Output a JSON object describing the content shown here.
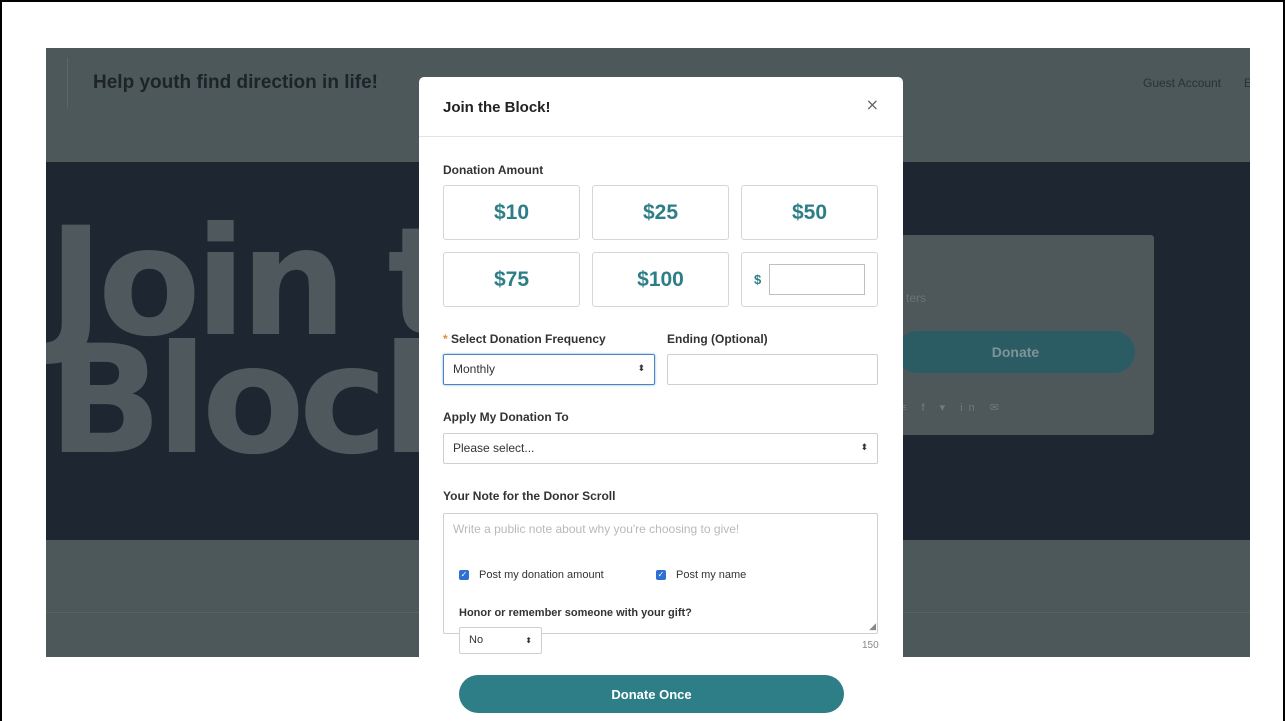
{
  "background": {
    "site_title": "Help youth find direction in life!",
    "guest_account": "Guest Account",
    "guest_extra": "E",
    "hero_line1": "Join th",
    "hero_line2": "Block!",
    "card_text": "ters",
    "card_donate": "Donate",
    "card_social": "≡ f ▾ in ✉"
  },
  "modal": {
    "title": "Join the Block!",
    "close": "×",
    "donation_amount_label": "Donation Amount",
    "amounts": [
      "$10",
      "$25",
      "$50",
      "$75",
      "$100"
    ],
    "custom_prefix": "$",
    "custom_value": "",
    "frequency_label": "Select Donation Frequency",
    "required_mark": "*",
    "frequency_value": "Monthly",
    "ending_label": "Ending (Optional)",
    "ending_value": "",
    "apply_label": "Apply My Donation To",
    "apply_value": "Please select...",
    "note_label": "Your Note for the Donor Scroll",
    "note_placeholder": "Write a public note about why you're choosing to give!",
    "post_amount_label": "Post my donation amount",
    "post_name_label": "Post my name",
    "honor_label": "Honor or remember someone with your gift?",
    "honor_value": "No",
    "char_count": "150",
    "submit_label": "Donate Once"
  },
  "colors": {
    "accent": "#2e7e88",
    "checkbox": "#2f6fd2",
    "required": "#e08a3c"
  }
}
